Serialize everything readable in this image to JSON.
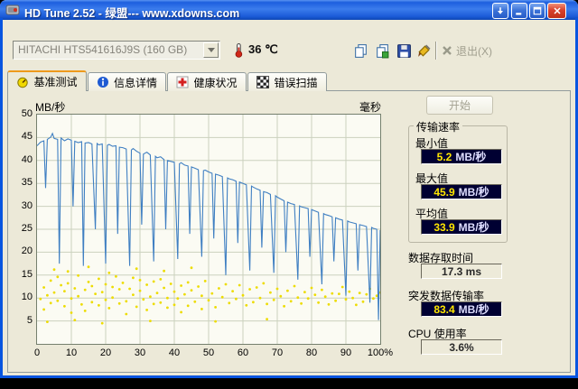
{
  "window": {
    "title": "HD Tune 2.52 - 绿盟--- www.xdowns.com"
  },
  "toolbar": {
    "drive": "HITACHI HTS541616J9S (160 GB)",
    "temperature": "36 ℃",
    "exit_label": "退出(X)"
  },
  "tabs": [
    {
      "label": "基准测试"
    },
    {
      "label": "信息详情"
    },
    {
      "label": "健康状况"
    },
    {
      "label": "错误扫描"
    }
  ],
  "start_button": "开始",
  "results": {
    "transfer_group_title": "传输速率",
    "min_label": "最小值",
    "min_value": "5.2",
    "min_unit": "MB/秒",
    "max_label": "最大值",
    "max_value": "45.9",
    "max_unit": "MB/秒",
    "avg_label": "平均值",
    "avg_value": "33.9",
    "avg_unit": "MB/秒",
    "access_label": "数据存取时间",
    "access_value": "17.3 ms",
    "burst_label": "突发数据传输率",
    "burst_value": "83.4",
    "burst_unit": "MB/秒",
    "cpu_label": "CPU 使用率",
    "cpu_value": "3.6%"
  },
  "chart_data": {
    "type": "line",
    "title": "HD Tune benchmark transfer rate and access time",
    "left_axis_label": "MB/秒",
    "right_axis_label": "毫秒",
    "xlim": [
      0,
      100
    ],
    "ylim": [
      0,
      50
    ],
    "y_ticks": [
      50,
      45,
      40,
      35,
      30,
      25,
      20,
      15,
      10,
      5
    ],
    "x_ticks": [
      "0",
      "10",
      "20",
      "30",
      "40",
      "50",
      "60",
      "70",
      "80",
      "90",
      "100%"
    ],
    "line_color": "#3F7FC2",
    "dot_color": "#EDDC00",
    "grid_color": "#CBD1BE",
    "transfer_line": [
      [
        0,
        43.2
      ],
      [
        1,
        44.0
      ],
      [
        2,
        44.3
      ],
      [
        2.5,
        34
      ],
      [
        3,
        44.6
      ],
      [
        4,
        45.1
      ],
      [
        4.5,
        45.9
      ],
      [
        5,
        44.8
      ],
      [
        6,
        44.6
      ],
      [
        6.5,
        17.5
      ],
      [
        7,
        44.9
      ],
      [
        8,
        44.3
      ],
      [
        9,
        44.7
      ],
      [
        10,
        44.4
      ],
      [
        10.5,
        30
      ],
      [
        11,
        44.2
      ],
      [
        12,
        43.9
      ],
      [
        13,
        44.1
      ],
      [
        13.5,
        17
      ],
      [
        14,
        43.8
      ],
      [
        15,
        43.9
      ],
      [
        16,
        43.6
      ],
      [
        17,
        25
      ],
      [
        17.5,
        43.7
      ],
      [
        18,
        43.4
      ],
      [
        19,
        43.6
      ],
      [
        20,
        17.5
      ],
      [
        20.5,
        43.3
      ],
      [
        21,
        43.5
      ],
      [
        22,
        43.1
      ],
      [
        23,
        43.2
      ],
      [
        23.5,
        24
      ],
      [
        24,
        42.9
      ],
      [
        25,
        42.8
      ],
      [
        26,
        42.5
      ],
      [
        27,
        17
      ],
      [
        27.5,
        42.3
      ],
      [
        28,
        42.6
      ],
      [
        29,
        42.0
      ],
      [
        30,
        41.6
      ],
      [
        30.5,
        26
      ],
      [
        31,
        41.4
      ],
      [
        32,
        41.8
      ],
      [
        33,
        41.2
      ],
      [
        34,
        18
      ],
      [
        34.5,
        40.9
      ],
      [
        35,
        40.6
      ],
      [
        36,
        40.8
      ],
      [
        37,
        40.2
      ],
      [
        37.5,
        25
      ],
      [
        38,
        40.0
      ],
      [
        39,
        39.8
      ],
      [
        40,
        39.6
      ],
      [
        41,
        18.5
      ],
      [
        41.5,
        39.3
      ],
      [
        42,
        39.5
      ],
      [
        43,
        39.0
      ],
      [
        44,
        38.8
      ],
      [
        44.5,
        24
      ],
      [
        45,
        38.6
      ],
      [
        46,
        38.3
      ],
      [
        47,
        38.0
      ],
      [
        48,
        19
      ],
      [
        48.5,
        37.8
      ],
      [
        49,
        37.9
      ],
      [
        50,
        37.5
      ],
      [
        51,
        37.2
      ],
      [
        51.5,
        23
      ],
      [
        52,
        37.0
      ],
      [
        53,
        36.8
      ],
      [
        54,
        36.5
      ],
      [
        55,
        15
      ],
      [
        55.5,
        36.2
      ],
      [
        56,
        36.0
      ],
      [
        57,
        35.8
      ],
      [
        58,
        35.5
      ],
      [
        58.5,
        22
      ],
      [
        59,
        35.3
      ],
      [
        60,
        35.0
      ],
      [
        61,
        34.7
      ],
      [
        62,
        16
      ],
      [
        62.5,
        34.4
      ],
      [
        63,
        34.2
      ],
      [
        64,
        33.8
      ],
      [
        65,
        33.5
      ],
      [
        65.5,
        21
      ],
      [
        66,
        33.2
      ],
      [
        67,
        33.0
      ],
      [
        68,
        32.6
      ],
      [
        69,
        15.5
      ],
      [
        69.5,
        32.3
      ],
      [
        70,
        32.0
      ],
      [
        71,
        31.6
      ],
      [
        72,
        31.2
      ],
      [
        72.5,
        20
      ],
      [
        73,
        30.9
      ],
      [
        74,
        30.6
      ],
      [
        75,
        30.4
      ],
      [
        76,
        14
      ],
      [
        76.5,
        30.1
      ],
      [
        77,
        29.9
      ],
      [
        78,
        29.7
      ],
      [
        79,
        29.5
      ],
      [
        79.5,
        19
      ],
      [
        80,
        29.3
      ],
      [
        81,
        29.0
      ],
      [
        82,
        28.7
      ],
      [
        83,
        13
      ],
      [
        83.5,
        28.4
      ],
      [
        84,
        28.2
      ],
      [
        85,
        28.0
      ],
      [
        86,
        27.7
      ],
      [
        86.5,
        18
      ],
      [
        87,
        27.5
      ],
      [
        88,
        27.2
      ],
      [
        89,
        27.0
      ],
      [
        90,
        10.5
      ],
      [
        90.5,
        26.8
      ],
      [
        91,
        26.6
      ],
      [
        92,
        26.4
      ],
      [
        93,
        26.2
      ],
      [
        93.5,
        16
      ],
      [
        94,
        26.0
      ],
      [
        95,
        25.8
      ],
      [
        96,
        25.6
      ],
      [
        97,
        9
      ],
      [
        97.5,
        25.4
      ],
      [
        98,
        25.2
      ],
      [
        99,
        25.0
      ],
      [
        99.5,
        5.2
      ],
      [
        100,
        24.8
      ]
    ],
    "access_dots": [
      [
        1,
        9.8
      ],
      [
        2,
        12.3
      ],
      [
        2,
        7.5
      ],
      [
        3,
        10.6
      ],
      [
        3,
        4.8
      ],
      [
        4,
        8.9
      ],
      [
        4,
        13.8
      ],
      [
        5,
        11.2
      ],
      [
        5,
        16.2
      ],
      [
        6,
        9.4
      ],
      [
        6,
        14.6
      ],
      [
        7,
        12.8
      ],
      [
        8,
        8.2
      ],
      [
        8,
        11.5
      ],
      [
        9,
        13.2
      ],
      [
        9,
        15.8
      ],
      [
        10,
        9.9
      ],
      [
        10,
        6.8
      ],
      [
        11,
        12.1
      ],
      [
        11,
        5.2
      ],
      [
        12,
        10.4
      ],
      [
        12,
        14.9
      ],
      [
        13,
        8.6
      ],
      [
        14,
        11.8
      ],
      [
        14,
        7.2
      ],
      [
        15,
        13.5
      ],
      [
        15,
        16.8
      ],
      [
        16,
        9.1
      ],
      [
        16,
        12.6
      ],
      [
        17,
        10.9
      ],
      [
        18,
        8.4
      ],
      [
        18,
        14.2
      ],
      [
        19,
        11.3
      ],
      [
        19,
        4.5
      ],
      [
        20,
        9.6
      ],
      [
        20,
        13.0
      ],
      [
        21,
        7.8
      ],
      [
        21,
        15.5
      ],
      [
        22,
        12.4
      ],
      [
        22,
        10.1
      ],
      [
        23,
        14.7
      ],
      [
        24,
        8.8
      ],
      [
        24,
        11.9
      ],
      [
        25,
        13.3
      ],
      [
        26,
        9.3
      ],
      [
        26,
        6.5
      ],
      [
        27,
        12.0
      ],
      [
        28,
        10.7
      ],
      [
        28,
        14.4
      ],
      [
        29,
        8.1
      ],
      [
        29,
        16.4
      ],
      [
        30,
        11.6
      ],
      [
        30,
        13.9
      ],
      [
        31,
        9.7
      ],
      [
        32,
        12.9
      ],
      [
        32,
        7.4
      ],
      [
        33,
        10.3
      ],
      [
        33,
        5.0
      ],
      [
        34,
        13.6
      ],
      [
        34,
        8.7
      ],
      [
        35,
        11.1
      ],
      [
        36,
        9.0
      ],
      [
        36,
        14.1
      ],
      [
        37,
        12.2
      ],
      [
        37,
        15.9
      ],
      [
        38,
        10.0
      ],
      [
        38,
        7.9
      ],
      [
        39,
        13.1
      ],
      [
        40,
        8.5
      ],
      [
        40,
        11.4
      ],
      [
        41,
        9.9
      ],
      [
        42,
        12.7
      ],
      [
        42,
        6.9
      ],
      [
        43,
        10.8
      ],
      [
        44,
        13.4
      ],
      [
        44,
        8.3
      ],
      [
        45,
        11.7
      ],
      [
        45,
        16.6
      ],
      [
        46,
        9.2
      ],
      [
        47,
        12.5
      ],
      [
        48,
        10.5
      ],
      [
        48,
        7.6
      ],
      [
        49,
        13.7
      ],
      [
        50,
        9.5
      ],
      [
        51,
        11.0
      ],
      [
        52,
        8.0
      ],
      [
        52,
        4.9
      ],
      [
        53,
        12.1
      ],
      [
        54,
        10.2
      ],
      [
        55,
        13.0
      ],
      [
        56,
        8.9
      ],
      [
        57,
        11.5
      ],
      [
        58,
        9.8
      ],
      [
        59,
        12.8
      ],
      [
        60,
        10.6
      ],
      [
        61,
        8.4
      ],
      [
        62,
        11.9
      ],
      [
        63,
        9.1
      ],
      [
        64,
        12.3
      ],
      [
        65,
        10.0
      ],
      [
        66,
        13.2
      ],
      [
        67,
        8.7
      ],
      [
        67,
        5.4
      ],
      [
        68,
        11.2
      ],
      [
        69,
        9.6
      ],
      [
        70,
        12.0
      ],
      [
        71,
        10.4
      ],
      [
        72,
        8.2
      ],
      [
        73,
        11.6
      ],
      [
        74,
        9.3
      ],
      [
        75,
        12.6
      ],
      [
        76,
        10.1
      ],
      [
        77,
        8.8
      ],
      [
        78,
        11.3
      ],
      [
        79,
        9.9
      ],
      [
        80,
        12.2
      ],
      [
        81,
        10.7
      ],
      [
        82,
        9.0
      ],
      [
        83,
        11.8
      ],
      [
        84,
        10.3
      ],
      [
        85,
        8.6
      ],
      [
        86,
        11.0
      ],
      [
        87,
        9.4
      ],
      [
        88,
        10.9
      ],
      [
        89,
        12.4
      ],
      [
        90,
        9.7
      ],
      [
        91,
        11.4
      ],
      [
        92,
        10.0
      ],
      [
        93,
        8.5
      ],
      [
        94,
        11.1
      ],
      [
        95,
        9.2
      ],
      [
        96,
        10.8
      ],
      [
        97,
        12.0
      ],
      [
        98,
        9.9
      ],
      [
        99,
        10.5
      ],
      [
        100,
        11.2
      ]
    ]
  }
}
